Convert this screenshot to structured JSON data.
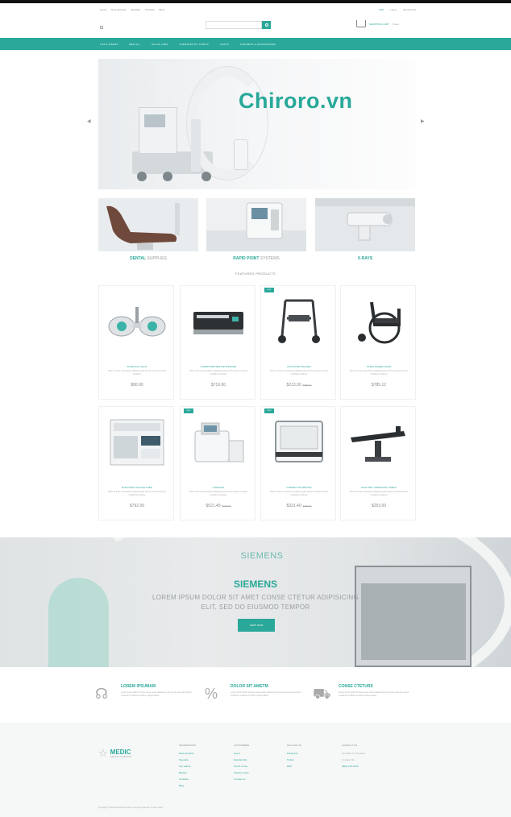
{
  "watermark": "Chiroro.vn",
  "top": {
    "links": [
      "Home",
      "New products",
      "Specials",
      "Contacts",
      "Blog"
    ],
    "lang": "USD",
    "account": "Log in",
    "register": "My Account"
  },
  "search": {
    "placeholder": ""
  },
  "cart": {
    "label": "SHOPPING CART",
    "count": "0 item"
  },
  "nav": [
    "LIFTS & BEDS",
    "BED ALL",
    "SCALE LABS",
    "THERAPEUTIC STRIPS",
    "CARTS",
    "CABINETS & ACCESSORIES"
  ],
  "categories": [
    {
      "bold": "DENTAL",
      "rest": "SUPPLIES"
    },
    {
      "bold": "RAPID POINT",
      "rest": "SYSTEMS"
    },
    {
      "bold": "X-RAYS",
      "rest": ""
    }
  ],
  "featured_title": "FEATURED PRODUCTS",
  "products": [
    {
      "name": "SURGICAL LIGHT",
      "desc": "Dolor sit amet consectetur adipisicing elit sed do eiusmod tempor incididunt",
      "price": "$80.00",
      "old": "",
      "badge": ""
    },
    {
      "name": "CURED PRINTER PROCESSOR",
      "desc": "Dolor sit amet consectetur adipisicing elit sed do eiusmod tempor incididunt ut labore",
      "price": "$719.00",
      "old": "",
      "badge": ""
    },
    {
      "name": "ROLLATOR WALKER",
      "desc": "Dolor sit amet consectetur adipisicing elit sed do eiusmod tempor incididunt ut labore",
      "price": "$213.00",
      "old": "$250.00",
      "badge": "NEW"
    },
    {
      "name": "STEEL WHEELCHAIR",
      "desc": "Dolor sit amet consectetur adipisicing elit sed do eiusmod tempor incididunt ut labore",
      "price": "$785.12",
      "old": "",
      "badge": ""
    },
    {
      "name": "ELECTROLYTE ANALYZER",
      "desc": "Dolor sit amet consectetur adipisicing elit sed do eiusmod tempor incididunt ut labore",
      "price": "$792.00",
      "old": "",
      "badge": ""
    },
    {
      "name": "CONSOLE",
      "desc": "Dolor sit amet consectetur adipisicing elit sed do eiusmod tempor incididunt ut labore",
      "price": "$521.45",
      "old": "$600.00",
      "badge": "NEW"
    },
    {
      "name": "CABINET INCUBATOR",
      "desc": "Dolor sit amet consectetur adipisicing elit sed do eiusmod tempor incididunt ut labore",
      "price": "$321.40",
      "old": "$400.00",
      "badge": "NEW"
    },
    {
      "name": "ELECTRIC OPERATING TABLE",
      "desc": "Dolor sit amet consectetur adipisicing elit sed do eiusmod tempor incididunt ut labore",
      "price": "$253.00",
      "old": "",
      "badge": ""
    }
  ],
  "banner": {
    "brand": "SIEMENS",
    "heading": "SIEMENS",
    "line1": "LOREM IPSUM DOLOR SIT AMET CONSE CTETUR ADIPISICING",
    "line2": "ELIT, SED DO EIUSMOD TEMPOR",
    "button": "SHOP NOW"
  },
  "features": [
    {
      "title": "LOREM IPSUMAM",
      "desc": "Lorem ipsum dolor sit amet conse ctetur adipisicing elit sed do eiusmod tempor incididunt ut labore et dolore magna aliqua"
    },
    {
      "title": "DOLOR SIT AMETM",
      "desc": "Lorem ipsum dolor sit amet conse ctetur adipisicing elit sed do eiusmod tempor incididunt ut labore et dolore magna aliqua"
    },
    {
      "title": "CONSE CTETURS",
      "desc": "Lorem ipsum dolor sit amet conse ctetur adipisicing elit sed do eiusmod tempor incididunt ut labore et dolore magna aliqua"
    }
  ],
  "footer": {
    "logo": "MEDIC",
    "logo_sub": "MEDICAL EQUIPMENT",
    "col1": {
      "title": "INFORMATION",
      "items": [
        "New products",
        "Specials",
        "Top sellers",
        "Brands",
        "Contacts",
        "Blog"
      ]
    },
    "col2": {
      "title": "CUSTOMERS",
      "items": [
        "Log in",
        "Special offer",
        "Terms of use",
        "Privacy notice",
        "Contact us"
      ]
    },
    "col3": {
      "title": "FOLLOW US",
      "items": [
        "Facebook",
        "Twitter",
        "RSS"
      ]
    },
    "col4": {
      "title": "CONTACT US",
      "items": [
        "123 Main St, Anytown",
        "Contact info"
      ],
      "phone": "(800) 123-1234"
    },
    "copyright": "Copyright © Medical Equipment Store. All rights reserved. Privacy notice"
  }
}
